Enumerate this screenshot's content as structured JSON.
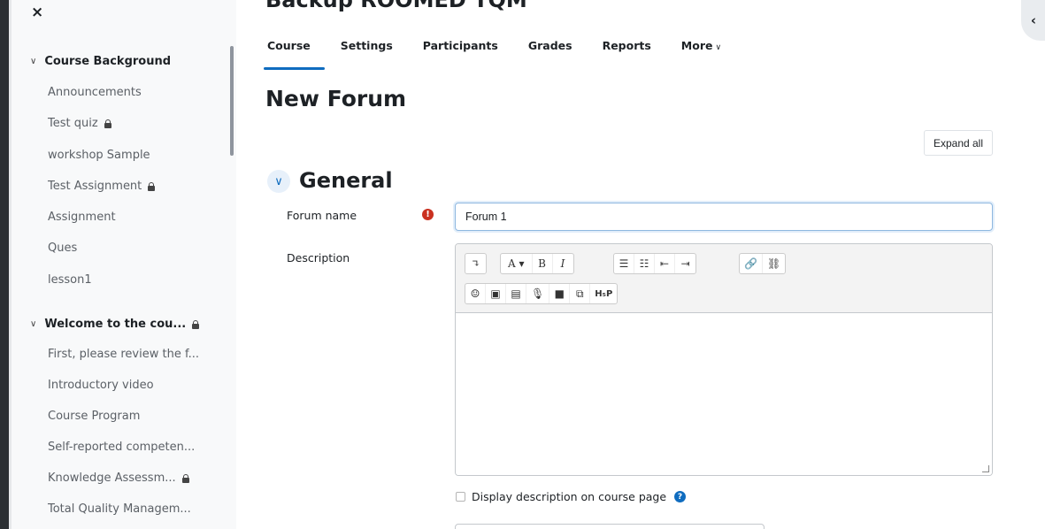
{
  "drawer": {
    "close_label": "×",
    "sections": [
      {
        "title": "Course Background",
        "items": [
          {
            "label": "Announcements",
            "locked": false
          },
          {
            "label": "Test quiz",
            "locked": true
          },
          {
            "label": "workshop Sample",
            "locked": false
          },
          {
            "label": "Test Assignment",
            "locked": true
          },
          {
            "label": "Assignment",
            "locked": false
          },
          {
            "label": "Ques",
            "locked": false
          },
          {
            "label": "lesson1",
            "locked": false
          }
        ]
      },
      {
        "title": "Welcome to the cou...",
        "locked": true,
        "items": [
          {
            "label": "First, please review the f...",
            "locked": false
          },
          {
            "label": "Introductory video",
            "locked": false
          },
          {
            "label": "Course Program",
            "locked": false
          },
          {
            "label": "Self-reported competen...",
            "locked": false
          },
          {
            "label": "Knowledge Assessm...",
            "locked": true
          },
          {
            "label": "Total Quality Managem...",
            "locked": false
          }
        ]
      }
    ]
  },
  "header": {
    "course_title": "Backup ROOMED TQM",
    "tabs": [
      {
        "label": "Course",
        "active": true
      },
      {
        "label": "Settings",
        "active": false
      },
      {
        "label": "Participants",
        "active": false
      },
      {
        "label": "Grades",
        "active": false
      },
      {
        "label": "Reports",
        "active": false
      },
      {
        "label": "More",
        "active": false
      }
    ]
  },
  "page": {
    "heading": "New Forum",
    "expand_all_label": "Expand all",
    "section_title": "General"
  },
  "form": {
    "forum_name_label": "Forum name",
    "forum_name_value": "Forum 1",
    "required_glyph": "!",
    "description_label": "Description",
    "display_description_label": "Display description on course page",
    "help_glyph": "?"
  },
  "editor": {
    "row1": [
      [
        "↴"
      ],
      [
        "A ▾",
        "B",
        "I"
      ],
      [
        "☰",
        "☷",
        "⇤",
        "⇥"
      ],
      [
        "🔗",
        "⛓"
      ]
    ],
    "row2": [
      "☺",
      "▣",
      "▤",
      "🎙",
      "■",
      "⧉",
      "H₅P"
    ]
  },
  "right_toggle_label": "‹",
  "colors": {
    "accent": "#0f6cbf",
    "required": "#ca3120",
    "drawer_bg": "#f8f9fa"
  }
}
